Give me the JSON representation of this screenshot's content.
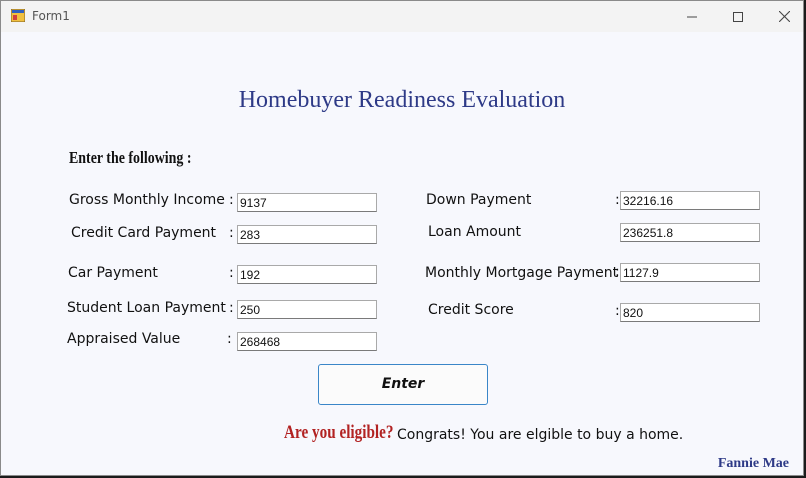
{
  "window": {
    "title": "Form1"
  },
  "heading": "Homebuyer Readiness Evaluation",
  "instruction": "Enter the following :",
  "colon": ":",
  "left_fields": [
    {
      "label": "Gross Monthly Income",
      "value": "9137"
    },
    {
      "label": "Credit Card Payment",
      "value": "283"
    },
    {
      "label": "Car Payment",
      "value": "192"
    },
    {
      "label": "Student Loan Payment",
      "value": "250"
    },
    {
      "label": "Appraised Value",
      "value": "268468"
    }
  ],
  "right_fields": [
    {
      "label": "Down Payment",
      "value": "32216.16"
    },
    {
      "label": "Loan Amount",
      "value": "236251.8"
    },
    {
      "label": "Monthly Mortgage Payment",
      "value": "1127.9"
    },
    {
      "label": "Credit Score",
      "value": "820"
    }
  ],
  "enter_button": "Enter",
  "eligibility": {
    "label": "Are you eligible?",
    "result": "Congrats! You are elgible to buy a home."
  },
  "brand": "Fannie Mae"
}
